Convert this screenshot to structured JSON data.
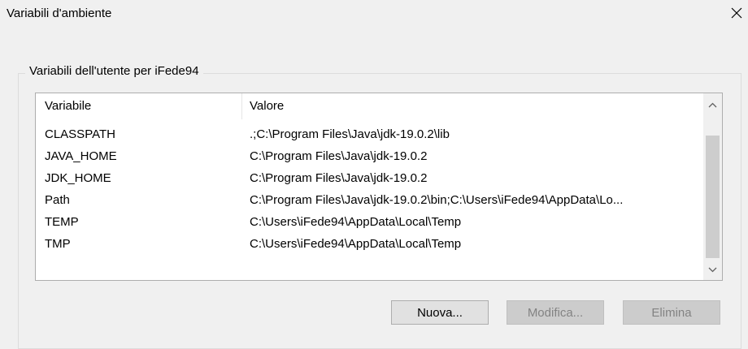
{
  "window": {
    "title": "Variabili d'ambiente",
    "close_icon": "close-icon"
  },
  "user_group": {
    "label": "Variabili dell'utente per iFede94",
    "columns": [
      "Variabile",
      "Valore"
    ],
    "rows": [
      {
        "name": "CLASSPATH",
        "value": ".;C:\\Program Files\\Java\\jdk-19.0.2\\lib"
      },
      {
        "name": "JAVA_HOME",
        "value": "C:\\Program Files\\Java\\jdk-19.0.2"
      },
      {
        "name": "JDK_HOME",
        "value": "C:\\Program Files\\Java\\jdk-19.0.2"
      },
      {
        "name": "Path",
        "value": "C:\\Program Files\\Java\\jdk-19.0.2\\bin;C:\\Users\\iFede94\\AppData\\Lo..."
      },
      {
        "name": "TEMP",
        "value": "C:\\Users\\iFede94\\AppData\\Local\\Temp"
      },
      {
        "name": "TMP",
        "value": "C:\\Users\\iFede94\\AppData\\Local\\Temp"
      }
    ],
    "buttons": {
      "new": "Nuova...",
      "edit": "Modifica...",
      "delete": "Elimina"
    }
  },
  "colors": {
    "background": "#f0f0f0",
    "list_background": "#ffffff",
    "disabled_text": "#838383",
    "scroll_thumb": "#cdcdcd"
  }
}
